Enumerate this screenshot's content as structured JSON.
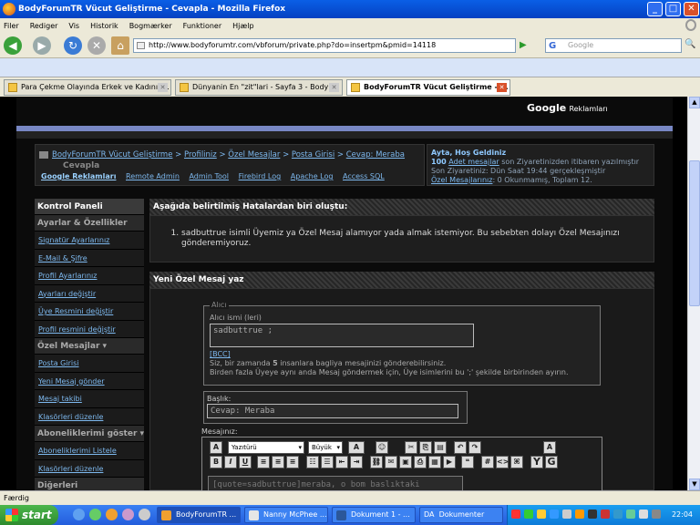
{
  "window": {
    "title": "BodyForumTR Vücut Geliştirme - Cevapla - Mozilla Firefox"
  },
  "menu": [
    "Filer",
    "Rediger",
    "Vis",
    "Historik",
    "Bogmærker",
    "Funktioner",
    "Hjælp"
  ],
  "nav": {
    "url": "http://www.bodyforumtr.com/vbforum/private.php?do=insertpm&pmid=14118",
    "search_placeholder": "Google"
  },
  "tabs": [
    {
      "label": "Para Çekme Olayında Erkek ve Kadının..."
    },
    {
      "label": "Dünyanin En \"zit\"lari - Sayfa 3 - BodyF..."
    },
    {
      "label": "BodyForumTR Vücut Geliştirme - ..."
    }
  ],
  "page": {
    "google_ads": {
      "google": "Google",
      "label": "Reklamları"
    },
    "breadcrumb": {
      "items": [
        "BodyForumTR Vücut Geliştirme",
        "Profiliniz",
        "Özel Mesajlar",
        "Posta Girisi",
        "Cevap: Meraba"
      ],
      "current": "Cevapla",
      "sep": ">"
    },
    "subnav": [
      "Google Reklamları",
      "Remote Admin",
      "Admin Tool",
      "Firebird Log",
      "Apache Log",
      "Access SQL"
    ],
    "user": {
      "greeting": "Ayta, Hoş Geldiniz",
      "line2_num": "100",
      "line2_link": "Adet mesajlar",
      "line2_rest": "son Ziyaretinizden itibaren yazılmıştır",
      "line3": "Son Ziyaretiniz: Dün Saat",
      "line3_time": "19:44",
      "line3_end": "gerçekleşmiştir",
      "line4_link": "Özel Mesajlarınız",
      "line4_rest": ": 0 Okunmamış, Toplam 12."
    },
    "sidebar": {
      "title": "Kontrol Paneli",
      "sec1": "Ayarlar & Özellikler",
      "sec1_items": [
        "Signatür Ayarlarınız",
        "E-Mail & Şifre",
        "Profil Ayarlarınız",
        "Ayarları değiştir",
        "Üye Resmini değiştir",
        "Profil resmini değiştir"
      ],
      "sec2": "Özel Mesajlar",
      "sec2_items": [
        "Posta Girisi",
        "Yeni Mesaj gönder",
        "Mesaj takibi",
        "Klasörleri düzenle"
      ],
      "sec3": "Aboneliklerimi göster",
      "sec3_items": [
        "Aboneliklerimi Listele",
        "Klasörleri düzenle"
      ],
      "sec4": "Diğerleri"
    },
    "error": {
      "title": "Aşağıda belirtilmiş Hatalardan biri oluştu:",
      "items": [
        "sadbuttrue isimli Üyemiz ya Özel Mesaj alamıyor yada almak istemiyor. Bu sebebten dolayı Özel Mesajınızı gönderemiyoruz."
      ]
    },
    "form": {
      "title": "Yeni Özel Mesaj yaz",
      "legend": "Alıcı",
      "recipient_label": "Alıcı ismi (leri)",
      "recipient_value": "sadbuttrue ;",
      "bcc": "[BCC]",
      "info1_a": "Siz, bir zamanda",
      "info1_num": "5",
      "info1_b": "insanlara bagliya mesajinizi gönderebilirsiniz.",
      "info2": "Birden fazla Üyeye aynı anda Mesaj göndermek için, Üye isimlerini bu ';' şekilde birbirinden ayırın.",
      "subject_label": "Başlık:",
      "subject_value": "Cevap: Meraba",
      "message_label": "Mesajınız:",
      "font_select": "Yazıtürü",
      "size_select": "Büyük",
      "message_value": "[quote=sadbuttrue]meraba, o bom baslıktaki"
    }
  },
  "status": "Færdig",
  "taskbar": {
    "start": "start",
    "tasks": [
      "BodyForumTR ...",
      "Nanny McPhee ...",
      "Dokument 1 - ...",
      "Dokumenter"
    ],
    "da": "DA",
    "clock": "22:04"
  }
}
